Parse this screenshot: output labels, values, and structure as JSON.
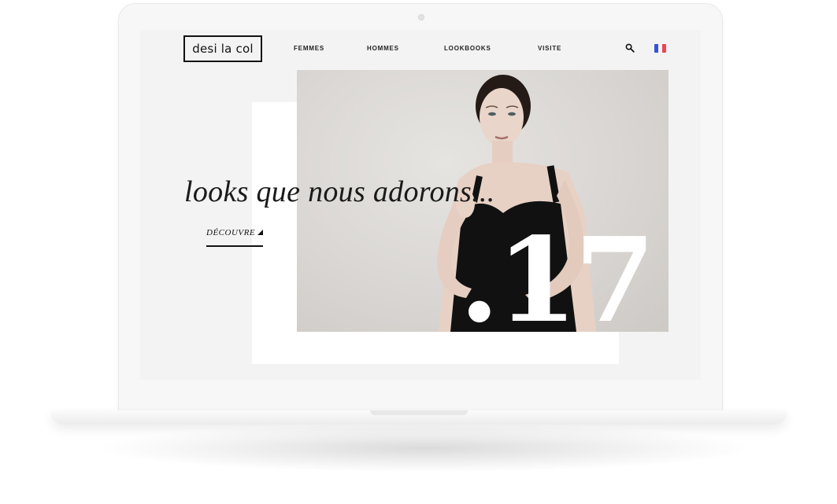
{
  "brand": {
    "logo_text": "desi la col"
  },
  "nav": {
    "items": [
      {
        "label": "FEMMES"
      },
      {
        "label": "HOMMES"
      },
      {
        "label": "LOOKBOOKS"
      },
      {
        "label": "VISITE"
      }
    ],
    "search_icon": "search-icon",
    "language_icon": "french-flag-icon"
  },
  "hero": {
    "tagline": "looks que nous adorons...",
    "cta_label": "DÉCOUVRE",
    "number": ".17",
    "image": "model-in-black-dress-photo"
  },
  "colors": {
    "text": "#1a1a1a",
    "screen_bg": "#f3f3f3",
    "photo_bg": "#d9d6d3",
    "flag_blue": "#3355d6",
    "flag_red": "#ef4455"
  }
}
